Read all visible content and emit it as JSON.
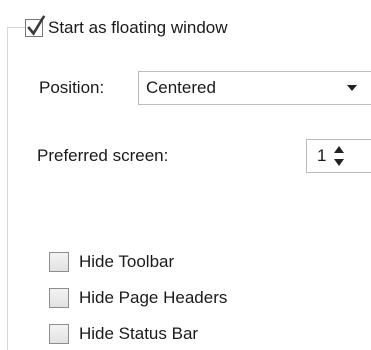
{
  "floating_window": {
    "label": "Start as floating window",
    "checked": true
  },
  "position": {
    "label": "Position:",
    "selected": "Centered"
  },
  "preferred_screen": {
    "label": "Preferred screen:",
    "value": "1"
  },
  "options": [
    {
      "label": "Hide Toolbar",
      "checked": false
    },
    {
      "label": "Hide Page Headers",
      "checked": false
    },
    {
      "label": "Hide Status Bar",
      "checked": false
    }
  ]
}
